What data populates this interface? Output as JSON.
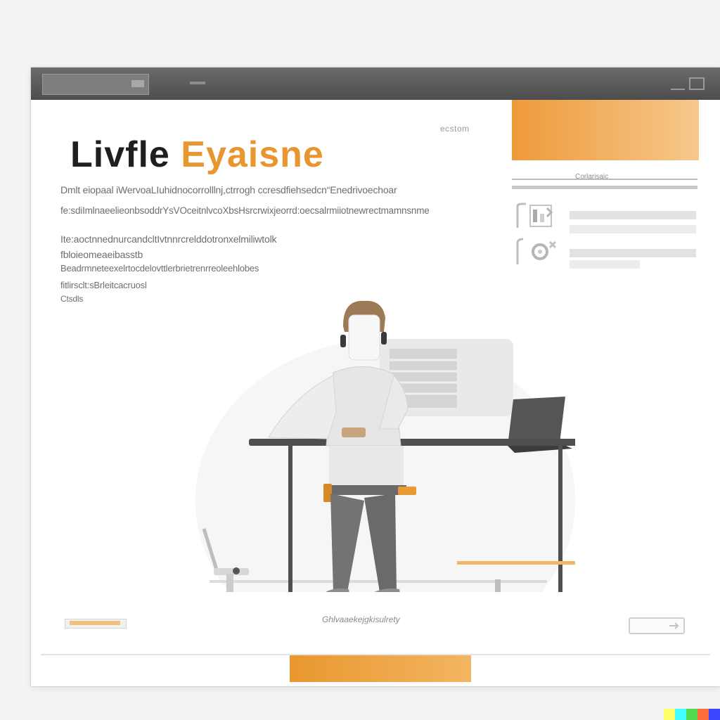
{
  "window": {
    "title_bar": {},
    "header": {
      "logo": {
        "word1": "Livfle",
        "word2": "Eyaisne"
      },
      "caption_right": "ecstom"
    },
    "body_text": [
      "Dmlt eiopaal iWervoaLIuhidnocorrolllnj,ctrrogh ccresdfiehsedcn“Enedrivoechoar",
      "fe:sdiImlnaeelieonbsoddrYsVOceitnlvcoXbsHsrcrwixjeorrd:oecsalrmiiotnewrectmamnsnme",
      "Ite:aoctnnednurcandcltIvtnnrcrelddotronxelmiliwtolk",
      "fbloieomeaeibasstb",
      "Beadrmneteexelrtocdelovttlerbrietrenrreoleehlobes",
      "fitlirsclt:sBrleitcacruosl",
      "Ctsdls"
    ],
    "sidebar": {
      "caption": "Corlarisaic",
      "icons": [
        "chart-icon",
        "settings-icon"
      ]
    },
    "scene": {
      "caption": "Ghlvaaekejgkisulrety"
    },
    "colors": {
      "accent": "#e8962f",
      "accent_light": "#f6c88c",
      "titlebar": "#555555",
      "text": "#6e6e6e"
    }
  }
}
